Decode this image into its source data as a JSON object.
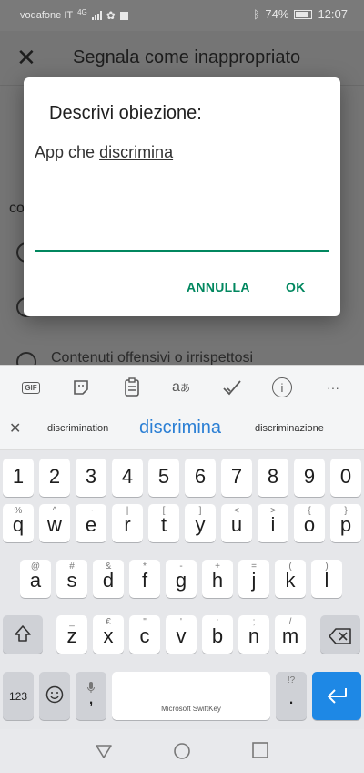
{
  "status_bar": {
    "carrier": "vodafone IT",
    "network": "4G",
    "battery": "74%",
    "time": "12:07"
  },
  "background_app": {
    "title": "Segnala come inappropriato",
    "partial_label": "co",
    "visible_option": "Contenuti offensivi o irrispettosi"
  },
  "dialog": {
    "title": "Descrivi obiezione:",
    "input_prefix": "App che ",
    "input_word": "discrimina",
    "cancel_label": "ANNULLA",
    "ok_label": "OK",
    "accent_color": "#01875f"
  },
  "keyboard": {
    "toolbar": {
      "gif_label": "GIF",
      "more_label": "···",
      "info_label": "i"
    },
    "suggestions": [
      "discrimination",
      "discrimina",
      "discriminazione"
    ],
    "number_row": [
      "1",
      "2",
      "3",
      "4",
      "5",
      "6",
      "7",
      "8",
      "9",
      "0"
    ],
    "row1": {
      "keys": [
        "q",
        "w",
        "e",
        "r",
        "t",
        "y",
        "u",
        "i",
        "o",
        "p"
      ],
      "hints": [
        "%",
        "^",
        "~",
        "|",
        "[",
        "]",
        "<",
        ">",
        "{",
        "}"
      ]
    },
    "row2": {
      "keys": [
        "a",
        "s",
        "d",
        "f",
        "g",
        "h",
        "j",
        "k",
        "l"
      ],
      "hints": [
        "@",
        "#",
        "&",
        "*",
        "-",
        "+",
        "=",
        "(",
        ")"
      ]
    },
    "row3": {
      "keys": [
        "z",
        "x",
        "c",
        "v",
        "b",
        "n",
        "m"
      ],
      "hints": [
        "_",
        "€",
        "\"",
        "'",
        ":",
        ";",
        "/"
      ]
    },
    "num_switch_label": "123",
    "comma": ",",
    "period": ".",
    "period_hint": "!?",
    "space_label": "Microsoft SwiftKey",
    "enter_color": "#1e88e5"
  }
}
